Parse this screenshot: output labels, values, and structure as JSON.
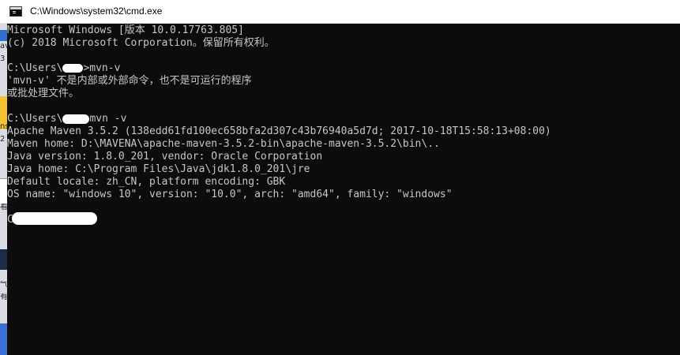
{
  "window": {
    "title": "C:\\Windows\\system32\\cmd.exe",
    "icon": "cmd-console-icon"
  },
  "desktop_edge": {
    "glyphs": [
      "av",
      "3",
      "ns",
      "2",
      "看",
      "气",
      "有"
    ]
  },
  "console": {
    "lines": [
      "Microsoft Windows [版本 10.0.17763.805]",
      "(c) 2018 Microsoft Corporation。保留所有权利。",
      "",
      "C:\\Users\\",
      ">mvn-v",
      "'mvn-v' 不是内部或外部命令，也不是可运行的程序",
      "或批处理文件。",
      "",
      "C:\\Users\\",
      "mvn -v",
      "Apache Maven 3.5.2 (138edd61fd100ec658bfa2d307c43b76940a5d7d; 2017-10-18T15:58:13+08:00)",
      "Maven home: D:\\MAVENA\\apache-maven-3.5.2-bin\\apache-maven-3.5.2\\bin\\..",
      "Java version: 1.8.0_201, vendor: Oracle Corporation",
      "Java home: C:\\Program Files\\Java\\jdk1.8.0_201\\jre",
      "Default locale: zh_CN, platform encoding: GBK",
      "OS name: \"windows 10\", version: \"10.0\", arch: \"amd64\", family: \"windows\"",
      "C"
    ]
  },
  "colors": {
    "console_bg": "#0c0c0c",
    "console_text": "#c7c7c7",
    "titlebar_bg": "#ffffff",
    "redaction": "#ffffff"
  }
}
